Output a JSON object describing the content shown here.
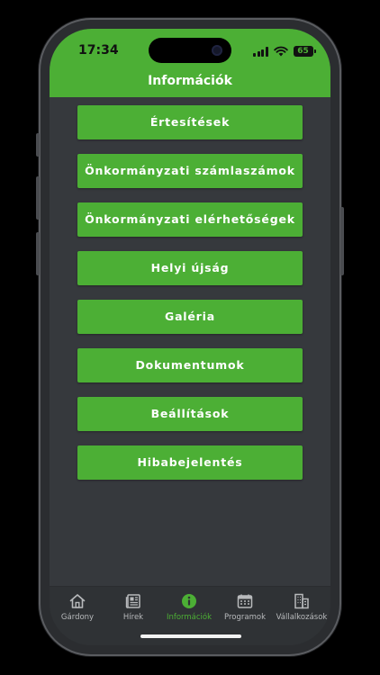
{
  "status_bar": {
    "time": "17:34",
    "battery": "65"
  },
  "header": {
    "title": "Információk"
  },
  "menu": [
    {
      "label": "Értesítések"
    },
    {
      "label": "Önkormányzati számlaszámok"
    },
    {
      "label": "Önkormányzati elérhetőségek"
    },
    {
      "label": "Helyi újság"
    },
    {
      "label": "Galéria"
    },
    {
      "label": "Dokumentumok"
    },
    {
      "label": "Beállítások"
    },
    {
      "label": "Hibabejelentés"
    }
  ],
  "tabs": [
    {
      "label": "Gárdony",
      "icon": "home-icon"
    },
    {
      "label": "Hírek",
      "icon": "newspaper-icon"
    },
    {
      "label": "Információk",
      "icon": "info-icon",
      "active": true
    },
    {
      "label": "Programok",
      "icon": "calendar-icon"
    },
    {
      "label": "Vállalkozások",
      "icon": "buildings-icon"
    }
  ],
  "colors": {
    "accent": "#4caf35",
    "background": "#36393d",
    "tabbar": "#2f3235",
    "inactive": "#b8babc"
  }
}
